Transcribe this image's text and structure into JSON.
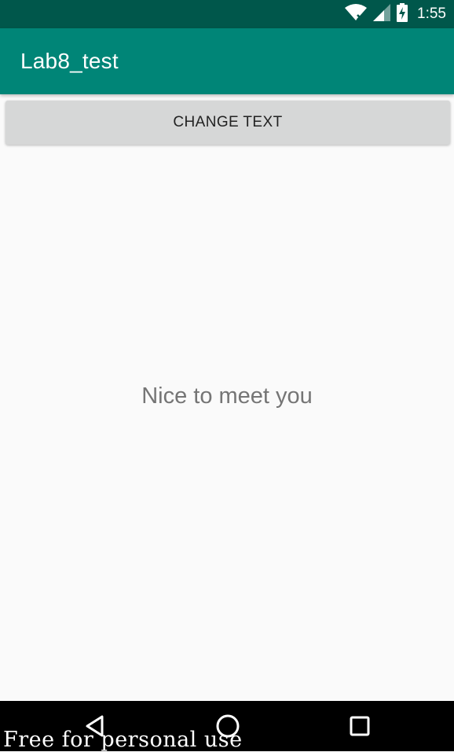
{
  "status_bar": {
    "time": "1:55",
    "icons": [
      "wifi-icon",
      "cell-signal-icon",
      "battery-charging-icon"
    ]
  },
  "app_bar": {
    "title": "Lab8_test",
    "color": "#008577"
  },
  "main": {
    "button_label": "CHANGE TEXT",
    "message": "Nice to meet you"
  },
  "nav_bar": {
    "buttons": [
      "back-icon",
      "home-icon",
      "recents-icon"
    ]
  },
  "watermark": "Free for personal use",
  "colors": {
    "status_bar": "#00574b",
    "app_bar": "#008577",
    "background": "#fafafa",
    "button": "#d6d7d7",
    "message_text": "#757575"
  }
}
